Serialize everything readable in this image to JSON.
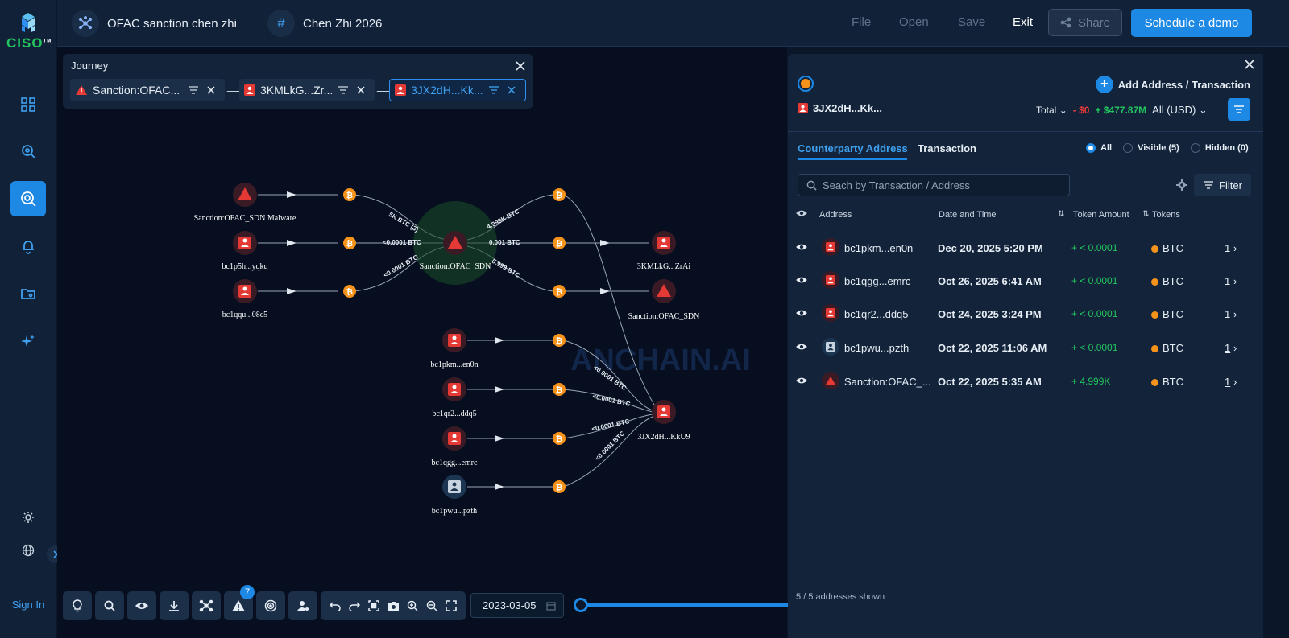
{
  "brand": {
    "name": "CISO",
    "tm": "TM"
  },
  "sidebar": {
    "sign_in": "Sign In"
  },
  "topbar": {
    "tabs": [
      {
        "label": "OFAC sanction chen zhi",
        "icon": "network-icon"
      },
      {
        "label": "Chen Zhi 2026",
        "icon": "hash-icon"
      }
    ],
    "menu": {
      "file": "File",
      "open": "Open",
      "save": "Save",
      "exit": "Exit"
    },
    "share": "Share",
    "schedule_demo": "Schedule a demo"
  },
  "journey": {
    "title": "Journey",
    "chips": [
      {
        "label": "Sanction:OFAC...",
        "icon": "warning-icon"
      },
      {
        "label": "3KMLkG...Zr...",
        "icon": "address-icon"
      },
      {
        "label": "3JX2dH...Kk...",
        "icon": "address-icon",
        "selected": true
      }
    ],
    "separator": "⟶"
  },
  "graph": {
    "watermark": "ANCHAIN.AI",
    "nodes": {
      "n1": "Sanction:OFAC_SDN  Malware",
      "n2": "bc1p5h...yqku",
      "n3": "bc1qqu...08c5",
      "center": "Sanction:OFAC_SDN",
      "r1": "3KMLkG...ZrAi",
      "r2": "Sanction:OFAC_SDN",
      "b1": "bc1pkm...en0n",
      "b2": "bc1qr2...ddq5",
      "b3": "bc1qgg...emrc",
      "b4": "bc1pwu...pzth",
      "target": "3JX2dH...KkU9"
    },
    "edges": {
      "e1": "5K BTC (3)",
      "e2": "<0.0001 BTC",
      "e3": "<0.0001 BTC",
      "e4": "4.999K BTC",
      "e5": "0.001 BTC",
      "e6": "0.999 BTC",
      "f1": "<0.0001 BTC",
      "f2": "<0.0001 BTC",
      "f3": "<0.0001 BTC",
      "f4": "<0.0001 BTC"
    }
  },
  "toolbar": {
    "tools": [
      "bulb-icon",
      "search-icon",
      "eye-icon",
      "download-icon",
      "network-icon",
      "warning-icon",
      "target-icon",
      "user-group-icon"
    ],
    "alert_count": "7",
    "history": [
      "undo-icon",
      "redo-icon",
      "fit-icon",
      "camera-icon",
      "zoom-in-icon",
      "zoom-out-icon",
      "fullscreen-icon"
    ],
    "date": "2023-03-05",
    "timeline_progress": 0.02
  },
  "panel": {
    "add_label": "Add Address / Transaction",
    "current_address": "3JX2dH...Kk...",
    "total_label": "Total",
    "out_value": "- $0",
    "in_value": "+ $477.87M",
    "currency": "All (USD)",
    "tabs": {
      "counterparty": "Counterparty Address",
      "transaction": "Transaction"
    },
    "filters": {
      "all": "All",
      "visible": "Visible (5)",
      "hidden": "Hidden (0)"
    },
    "search_placeholder": "Seach by Transaction / Address",
    "filter_label": "Filter",
    "columns": {
      "address": "Address",
      "datetime": "Date and Time",
      "amount": "Token Amount",
      "tokens": "Tokens"
    },
    "rows": [
      {
        "address": "bc1pkm...en0n",
        "date": "Dec 20, 2025 5:20 PM",
        "amount": "+ < 0.0001",
        "token": "BTC",
        "count": "1",
        "icon": "address-icon"
      },
      {
        "address": "bc1qgg...emrc",
        "date": "Oct 26, 2025 6:41 AM",
        "amount": "+ < 0.0001",
        "token": "BTC",
        "count": "1",
        "icon": "address-icon"
      },
      {
        "address": "bc1qr2...ddq5",
        "date": "Oct 24, 2025 3:24 PM",
        "amount": "+ < 0.0001",
        "token": "BTC",
        "count": "1",
        "icon": "address-icon"
      },
      {
        "address": "bc1pwu...pzth",
        "date": "Oct 22, 2025 11:06 AM",
        "amount": "+ < 0.0001",
        "token": "BTC",
        "count": "1",
        "icon": "address-plain-icon"
      },
      {
        "address": "Sanction:OFAC_...",
        "date": "Oct 22, 2025 5:35 AM",
        "amount": "+ 4.999K",
        "token": "BTC",
        "count": "1",
        "icon": "warning-icon"
      }
    ],
    "footer": "5 / 5 addresses shown"
  },
  "colors": {
    "accent": "#1e88e5",
    "danger": "#e53935",
    "positive": "#22c55e",
    "btc": "#f7931a"
  }
}
